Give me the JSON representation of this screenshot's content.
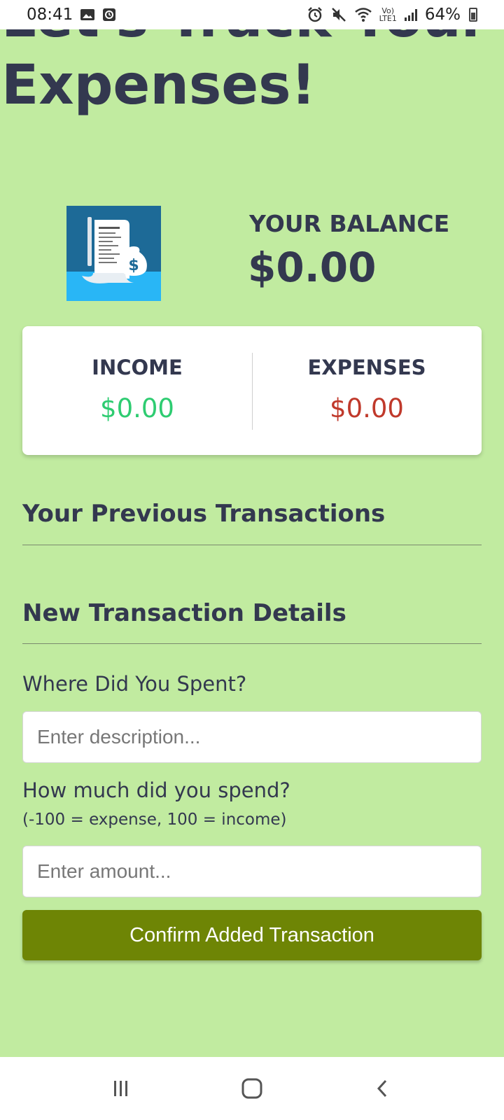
{
  "status_bar": {
    "time": "08:41",
    "battery": "64%",
    "network": "LTE1",
    "icons": [
      "image-icon",
      "clock-app-icon",
      "alarm-icon",
      "mute-icon",
      "wifi-icon",
      "volte-icon",
      "signal-icon",
      "battery-icon"
    ]
  },
  "app": {
    "title": "Let's Track Your Expenses!",
    "logo_icon": "receipt-money-bag-icon",
    "balance": {
      "label": "YOUR BALANCE",
      "value": "$0.00"
    },
    "summary": {
      "income_label": "INCOME",
      "income_value": "$0.00",
      "expenses_label": "EXPENSES",
      "expenses_value": "$0.00"
    },
    "history": {
      "title": "Your Previous Transactions"
    },
    "form": {
      "title": "New Transaction Details",
      "description_label": "Where Did You Spent?",
      "description_placeholder": "Enter description...",
      "description_value": "",
      "amount_label": "How much did you spend?",
      "amount_hint": "(-100 = expense, 100 = income)",
      "amount_placeholder": "Enter amount...",
      "amount_value": "",
      "submit_label": "Confirm Added Transaction"
    }
  },
  "colors": {
    "background": "#c1eba0",
    "text": "#33384f",
    "income": "#2ecc71",
    "expense": "#c0392b",
    "button": "#6e8505"
  },
  "nav_bar": {
    "icons": [
      "recent-apps-icon",
      "home-icon",
      "back-icon"
    ]
  }
}
